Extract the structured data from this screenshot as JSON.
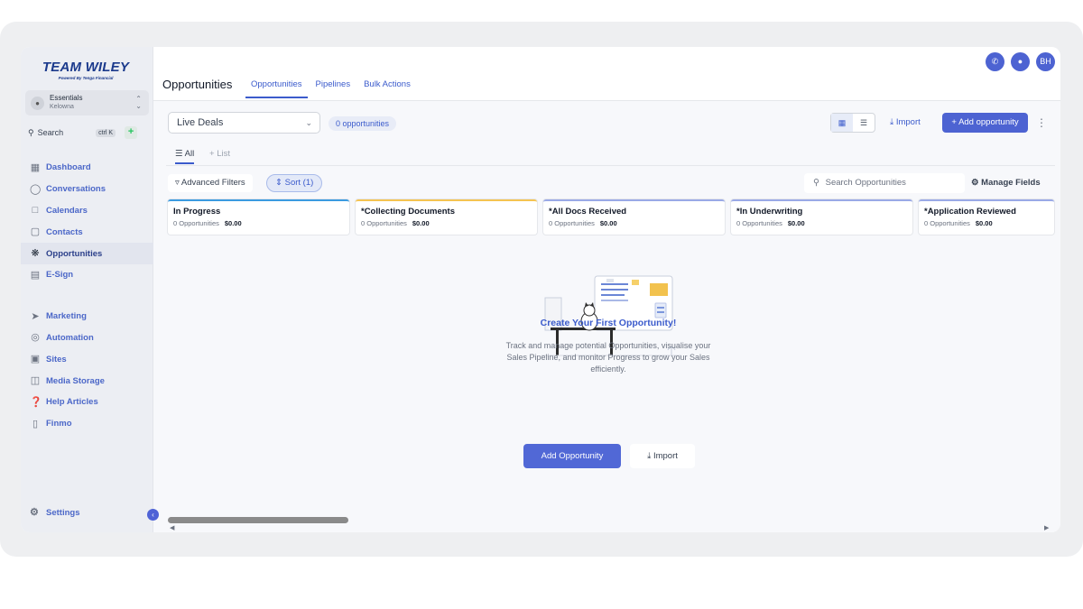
{
  "sidebar": {
    "logo": {
      "main": "TEAM WILEY",
      "sub": "Powered By Tenga Financial"
    },
    "account": {
      "name": "Essentials",
      "location": "Kelowna"
    },
    "search": {
      "label": "Search",
      "shortcut": "ctrl K"
    },
    "nav_primary": [
      {
        "label": "Dashboard",
        "icon": "dashboard-icon"
      },
      {
        "label": "Conversations",
        "icon": "chat-icon"
      },
      {
        "label": "Calendars",
        "icon": "calendar-icon"
      },
      {
        "label": "Contacts",
        "icon": "contacts-icon"
      },
      {
        "label": "Opportunities",
        "icon": "opportunities-icon",
        "active": true
      },
      {
        "label": "E-Sign",
        "icon": "esign-icon"
      }
    ],
    "nav_secondary": [
      {
        "label": "Marketing",
        "icon": "send-icon"
      },
      {
        "label": "Automation",
        "icon": "automation-icon"
      },
      {
        "label": "Sites",
        "icon": "sites-icon"
      },
      {
        "label": "Media Storage",
        "icon": "image-icon"
      },
      {
        "label": "Help Articles",
        "icon": "help-icon"
      },
      {
        "label": "Finmo",
        "icon": "finmo-icon"
      }
    ],
    "settings_label": "Settings"
  },
  "header": {
    "title": "Opportunities",
    "tabs": [
      {
        "label": "Opportunities",
        "active": true
      },
      {
        "label": "Pipelines"
      },
      {
        "label": "Bulk Actions"
      }
    ],
    "avatar_initials": "BH"
  },
  "toolbar": {
    "pipeline_select": "Live Deals",
    "count_badge": "0 opportunities",
    "import_label": "Import",
    "add_label": "Add opportunity"
  },
  "view_tabs": {
    "all": "All",
    "list": "List"
  },
  "filters": {
    "advanced": "Advanced Filters",
    "sort": "Sort (1)",
    "search_placeholder": "Search Opportunities",
    "manage_fields": "Manage Fields"
  },
  "stages": [
    {
      "name": "In Progress",
      "count": "0 Opportunities",
      "amount": "$0.00",
      "color": "#3b9be0"
    },
    {
      "name": "*Collecting Documents",
      "count": "0 Opportunities",
      "amount": "$0.00",
      "color": "#f5c451"
    },
    {
      "name": "*All Docs Received",
      "count": "0 Opportunities",
      "amount": "$0.00",
      "color": "#9aa9e6"
    },
    {
      "name": "*In Underwriting",
      "count": "0 Opportunities",
      "amount": "$0.00",
      "color": "#9aa9e6"
    },
    {
      "name": "*Application Reviewed",
      "count": "0 Opportunities",
      "amount": "$0.00",
      "color": "#9aa9e6"
    }
  ],
  "empty_state": {
    "title": "Create Your First Opportunity!",
    "description": "Track and manage potential Opportunities, visualise your Sales Pipeline, and monitor Progress to grow your Sales efficiently.",
    "add_button": "Add Opportunity",
    "import_button": "Import"
  },
  "colors": {
    "accent": "#4d63d2",
    "link": "#3b5bcc"
  }
}
